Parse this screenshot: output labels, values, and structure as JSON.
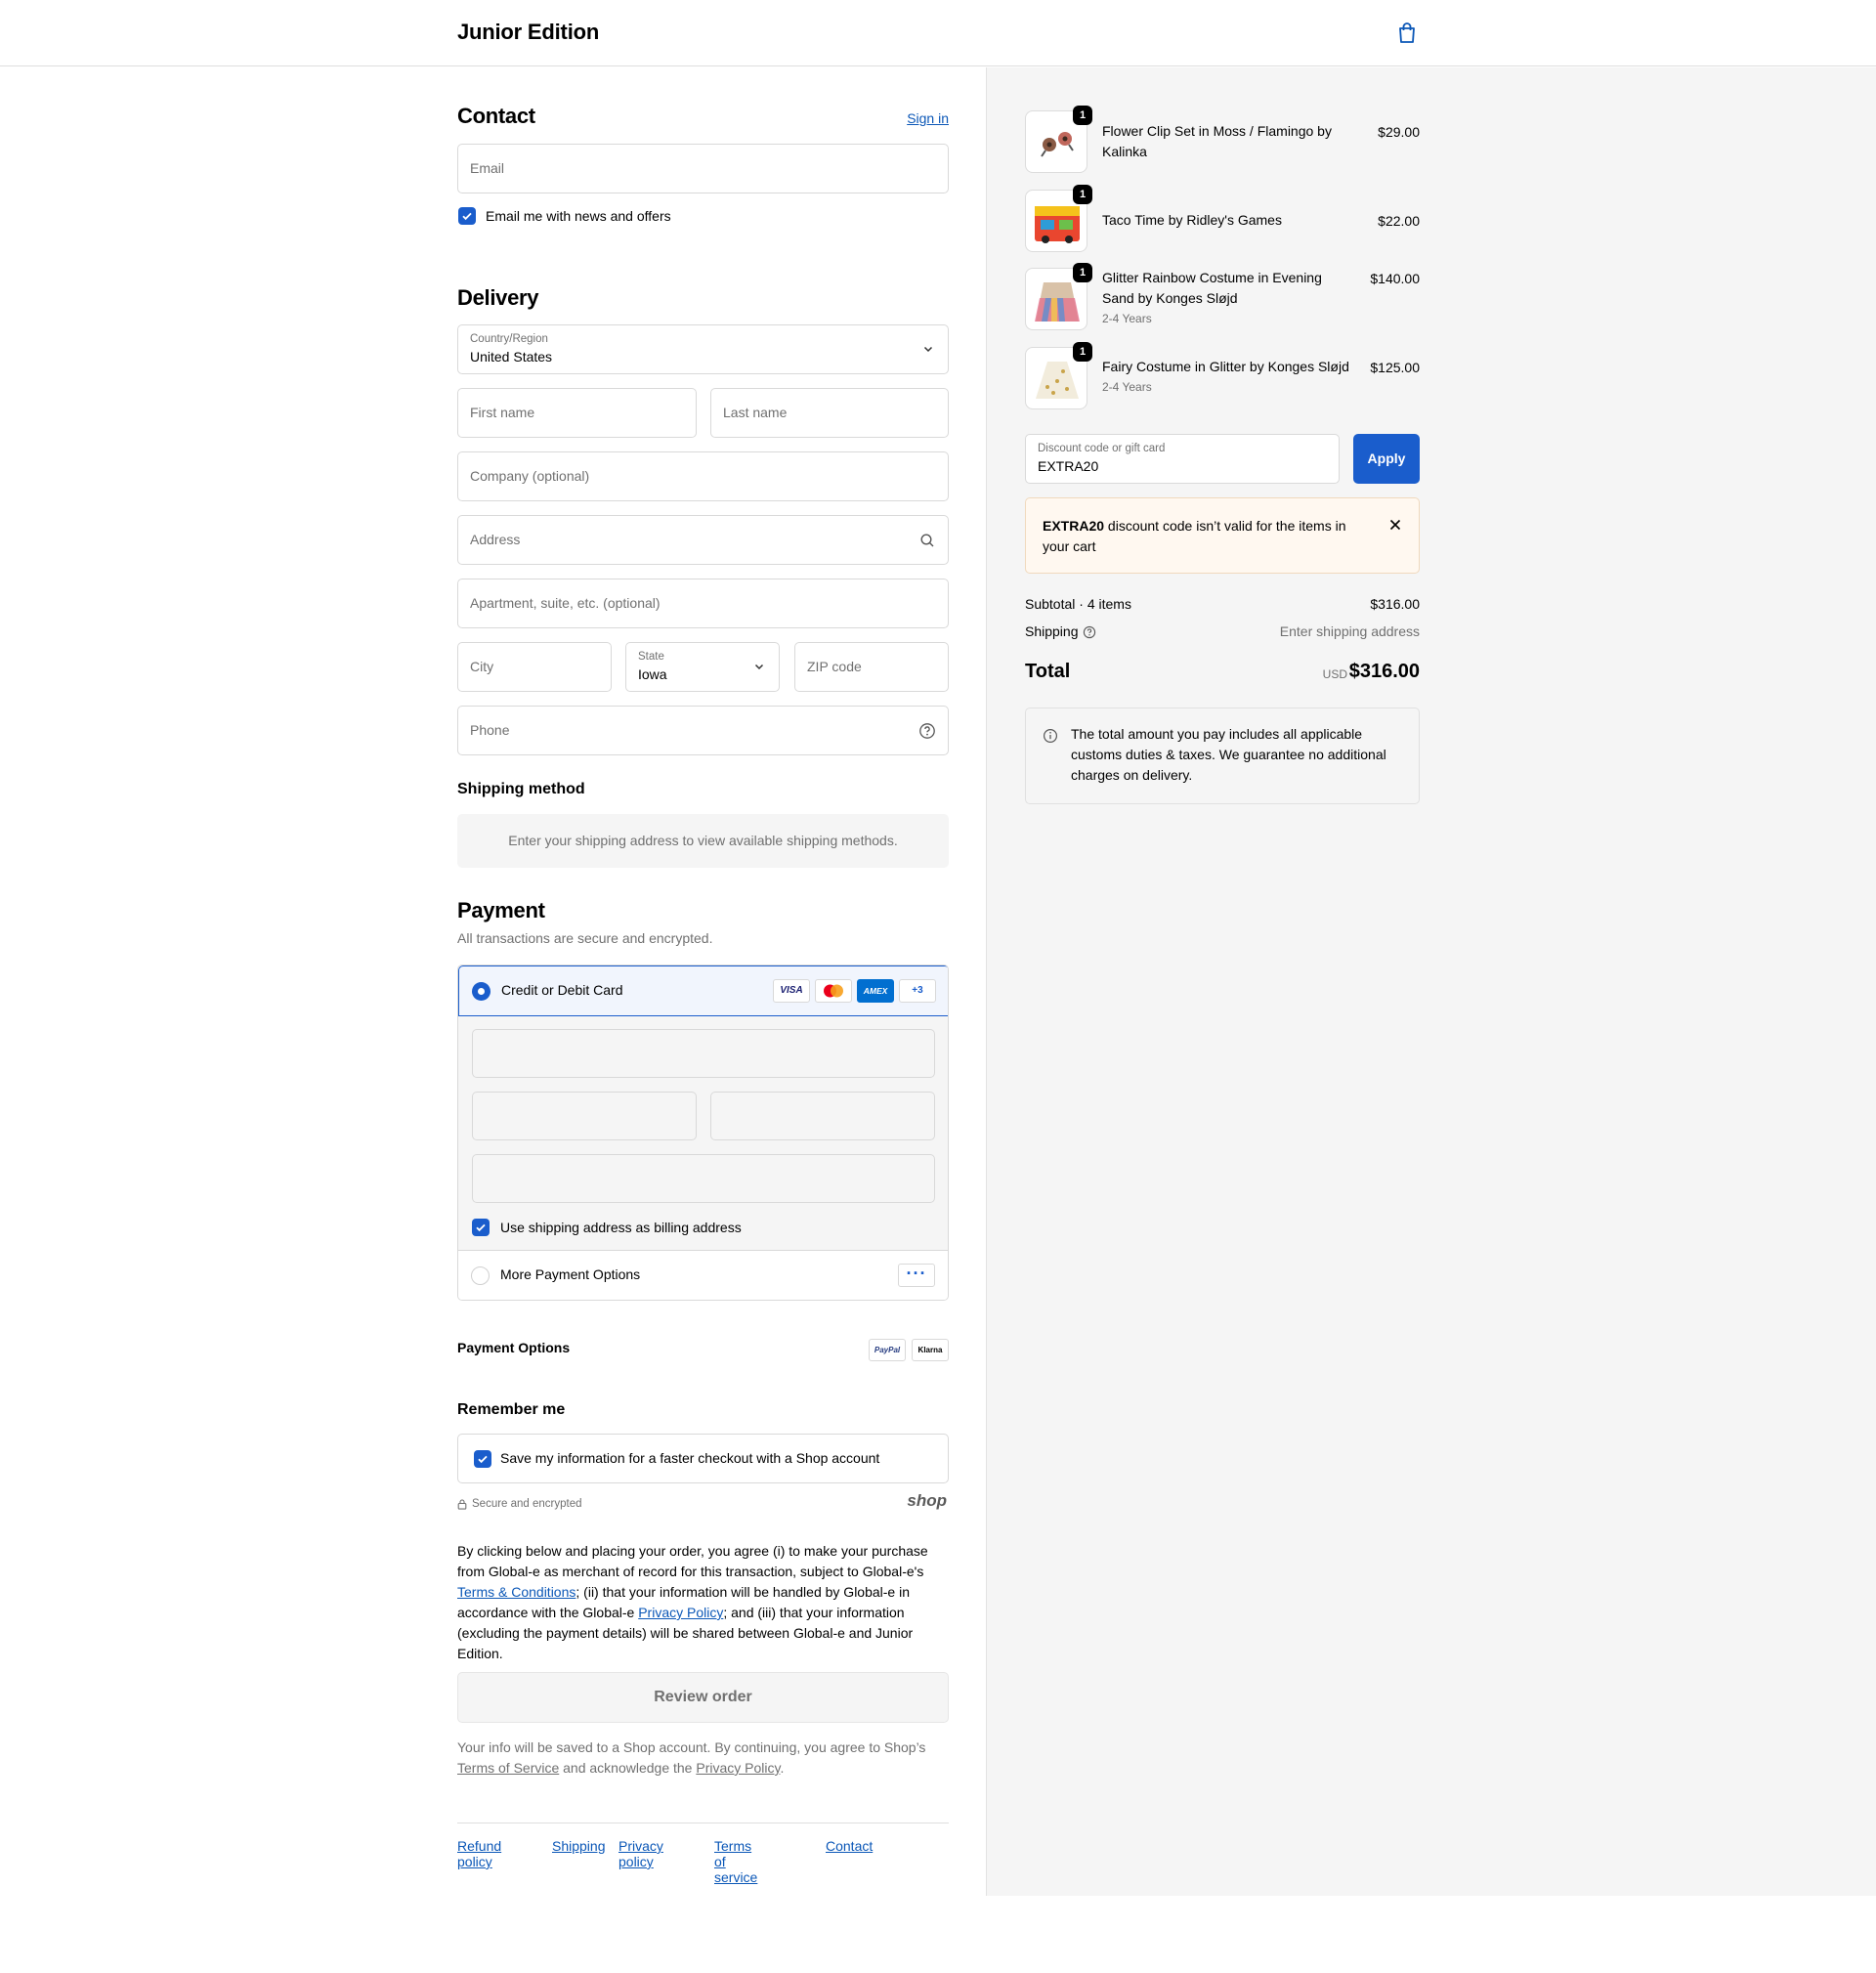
{
  "header": {
    "brand": "Junior Edition",
    "cart_icon": "shopping-bag-icon"
  },
  "contact": {
    "title": "Contact",
    "sign_in": "Sign in",
    "email_placeholder": "Email",
    "news_label": "Email me with news and offers",
    "news_checked": true
  },
  "delivery": {
    "title": "Delivery",
    "country_label": "Country/Region",
    "country_value": "United States",
    "first_name_placeholder": "First name",
    "last_name_placeholder": "Last name",
    "company_placeholder": "Company (optional)",
    "address_placeholder": "Address",
    "apartment_placeholder": "Apartment, suite, etc. (optional)",
    "city_placeholder": "City",
    "state_label": "State",
    "state_value": "Iowa",
    "zip_placeholder": "ZIP code",
    "phone_placeholder": "Phone"
  },
  "shipping_method": {
    "title": "Shipping method",
    "message": "Enter your shipping address to view available shipping methods."
  },
  "payment": {
    "title": "Payment",
    "subtitle": "All transactions are secure and encrypted.",
    "card_option": "Credit or Debit Card",
    "card_logos": [
      "VISA",
      "mastercard",
      "AMEX",
      "+3"
    ],
    "billing_label": "Use shipping address as billing address",
    "billing_checked": true,
    "more_options": "More Payment Options",
    "more_icon": "ellipsis-icon",
    "payment_options_title": "Payment Options",
    "payment_option_logos": [
      "PayPal",
      "Klarna"
    ]
  },
  "remember": {
    "title": "Remember me",
    "save_label": "Save my information for a faster checkout with a Shop account",
    "save_checked": true,
    "secure_label": "Secure and encrypted",
    "shop_logo": "shop"
  },
  "legal": {
    "p1": "By clicking below and placing your order, you agree (i) to make your purchase from Global-e as merchant of record for this transaction, subject to Global-e's ",
    "terms_link": "Terms & Conditions",
    "p2": "; (ii) that your information will be handled by Global-e in accordance with the Global-e ",
    "privacy_link": "Privacy Policy",
    "p3": "; and (iii) that your information (excluding the payment details) will be shared between Global-e and Junior Edition."
  },
  "review_button": "Review order",
  "shop_notice": {
    "p1": "Your info will be saved to a Shop account. By continuing, you agree to Shop’s ",
    "tos_link": "Terms of Service",
    "p2": " and acknowledge the ",
    "privacy_link": "Privacy Policy",
    "p3": "."
  },
  "footer": {
    "links": [
      "Refund policy",
      "Shipping",
      "Privacy policy",
      "Terms of service",
      "Contact"
    ]
  },
  "cart": {
    "items": [
      {
        "name": "Flower Clip Set in Moss / Flamingo by Kalinka",
        "variant": "",
        "price": "$29.00",
        "qty": "1"
      },
      {
        "name": "Taco Time by Ridley's Games",
        "variant": "",
        "price": "$22.00",
        "qty": "1"
      },
      {
        "name": "Glitter Rainbow Costume in Evening Sand by Konges Sløjd",
        "variant": "2-4 Years",
        "price": "$140.00",
        "qty": "1"
      },
      {
        "name": "Fairy Costume in Glitter by Konges Sløjd",
        "variant": "2-4 Years",
        "price": "$125.00",
        "qty": "1"
      }
    ],
    "discount_label": "Discount code or gift card",
    "discount_value": "EXTRA20",
    "apply": "Apply",
    "error_code": "EXTRA20",
    "error_text": " discount code isn’t valid for the items in your cart",
    "subtotal_label": "Subtotal · 4 items",
    "subtotal_value": "$316.00",
    "shipping_label": "Shipping",
    "shipping_value": "Enter shipping address",
    "total_label": "Total",
    "currency": "USD",
    "total_value": "$316.00",
    "duties_note": "The total amount you pay includes all applicable customs duties & taxes. We guarantee no additional charges on delivery."
  },
  "colors": {
    "accent": "#1a5dcc",
    "link": "#0b57b7",
    "error_bg": "#fff8f0",
    "sidebar_bg": "#f5f5f5"
  }
}
